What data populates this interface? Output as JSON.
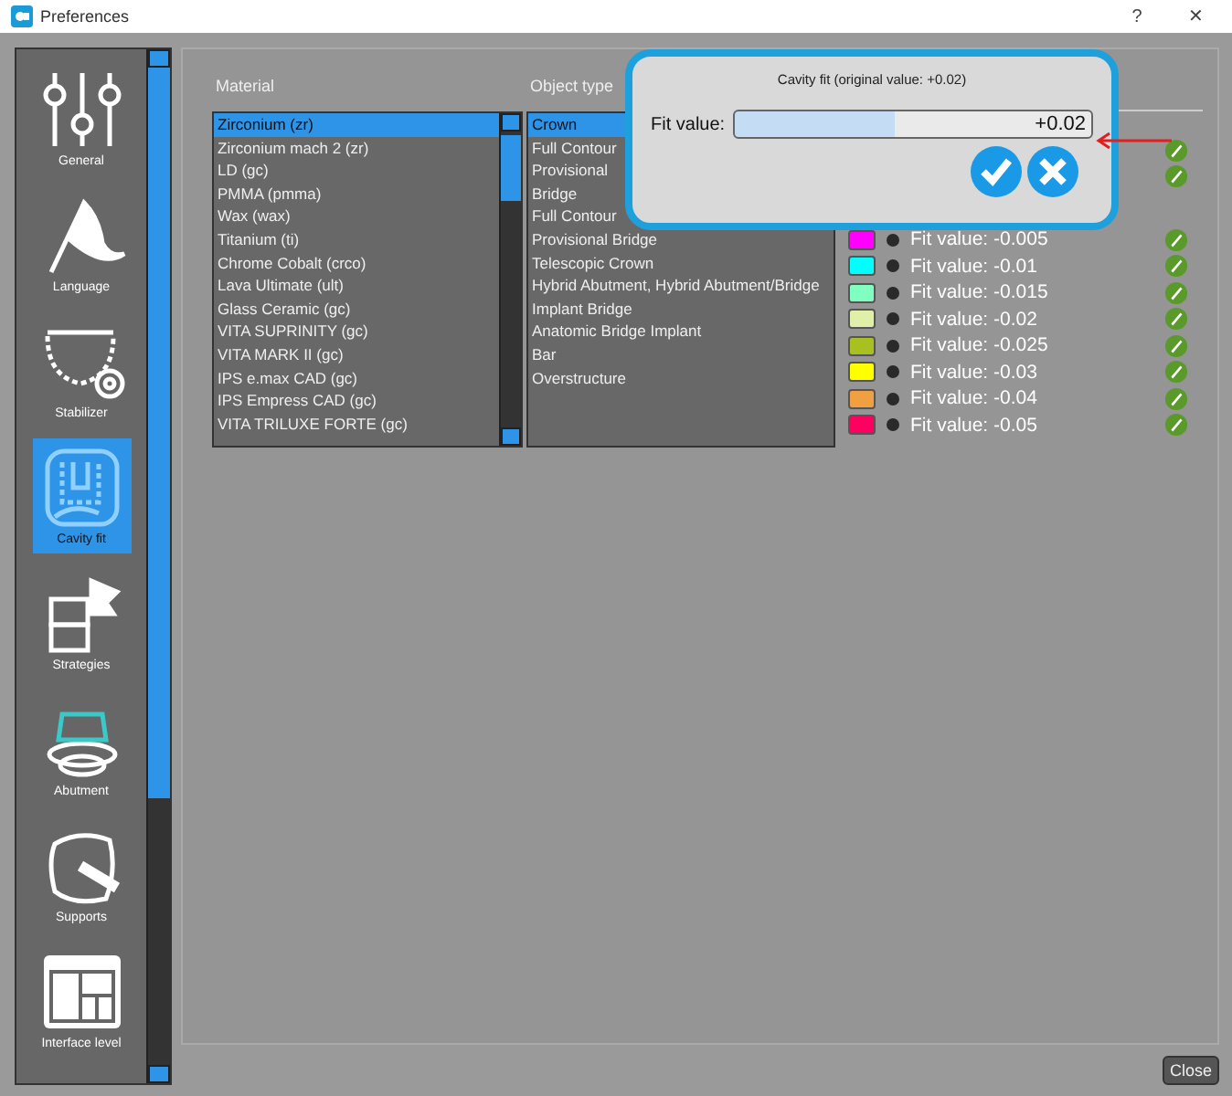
{
  "window": {
    "title": "Preferences",
    "help": "?",
    "close": "✕"
  },
  "sidebar": {
    "items": [
      {
        "label": "General",
        "selected": false
      },
      {
        "label": "Language",
        "selected": false
      },
      {
        "label": "Stabilizer",
        "selected": false
      },
      {
        "label": "Cavity fit",
        "selected": true
      },
      {
        "label": "Strategies",
        "selected": false
      },
      {
        "label": "Abutment",
        "selected": false
      },
      {
        "label": "Supports",
        "selected": false
      },
      {
        "label": "Interface level",
        "selected": false
      }
    ]
  },
  "material": {
    "heading": "Material",
    "items": [
      {
        "label": "Zirconium (zr)",
        "selected": true
      },
      {
        "label": "Zirconium mach 2 (zr)",
        "selected": false
      },
      {
        "label": "LD (gc)",
        "selected": false
      },
      {
        "label": "PMMA (pmma)",
        "selected": false
      },
      {
        "label": "Wax (wax)",
        "selected": false
      },
      {
        "label": "Titanium (ti)",
        "selected": false
      },
      {
        "label": "Chrome Cobalt (crco)",
        "selected": false
      },
      {
        "label": "Lava Ultimate (ult)",
        "selected": false
      },
      {
        "label": "Glass Ceramic (gc)",
        "selected": false
      },
      {
        "label": "VITA SUPRINITY (gc)",
        "selected": false
      },
      {
        "label": "VITA MARK II (gc)",
        "selected": false
      },
      {
        "label": "IPS e.max CAD (gc)",
        "selected": false
      },
      {
        "label": "IPS Empress CAD (gc)",
        "selected": false
      },
      {
        "label": "VITA TRILUXE FORTE (gc)",
        "selected": false
      }
    ]
  },
  "object_type": {
    "heading": "Object type",
    "items": [
      {
        "label": "Crown",
        "selected": true
      },
      {
        "label": "Full Contour",
        "selected": false
      },
      {
        "label": "Provisional",
        "selected": false
      },
      {
        "label": "Bridge",
        "selected": false
      },
      {
        "label": "Full Contour",
        "selected": false
      },
      {
        "label": "Provisional Bridge",
        "selected": false
      },
      {
        "label": "Telescopic Crown",
        "selected": false
      },
      {
        "label": "Hybrid Abutment, Hybrid Abutment/Bridge",
        "selected": false
      },
      {
        "label": "Implant Bridge",
        "selected": false
      },
      {
        "label": "Anatomic Bridge Implant",
        "selected": false
      },
      {
        "label": "Bar",
        "selected": false
      },
      {
        "label": "Overstructure",
        "selected": false
      }
    ]
  },
  "cavity_fit": {
    "rows": [
      {
        "editable": true
      },
      {
        "editable": true
      },
      {
        "editable": false
      },
      {
        "label": "Fit value: -0.005",
        "color": "#ff00ff",
        "selected": false,
        "editable": true
      },
      {
        "label": "Fit value: -0.01",
        "color": "#00ffff",
        "selected": false,
        "editable": true
      },
      {
        "label": "Fit value: -0.015",
        "color": "#80ffc0",
        "selected": false,
        "editable": true
      },
      {
        "label": "Fit value: -0.02",
        "color": "#e0f0a8",
        "selected": false,
        "editable": true
      },
      {
        "label": "Fit value: -0.025",
        "color": "#a8c020",
        "selected": false,
        "editable": true
      },
      {
        "label": "Fit value: -0.03",
        "color": "#ffff00",
        "selected": false,
        "editable": true
      },
      {
        "label": "Fit value: -0.04",
        "color": "#f0a040",
        "selected": false,
        "editable": true
      },
      {
        "label": "Fit value: -0.05",
        "color": "#ff0060",
        "selected": false,
        "editable": true
      }
    ]
  },
  "dialog": {
    "title": "Cavity fit (original value: +0.02)",
    "label": "Fit value:",
    "value": "+0.02"
  },
  "close_button": "Close"
}
